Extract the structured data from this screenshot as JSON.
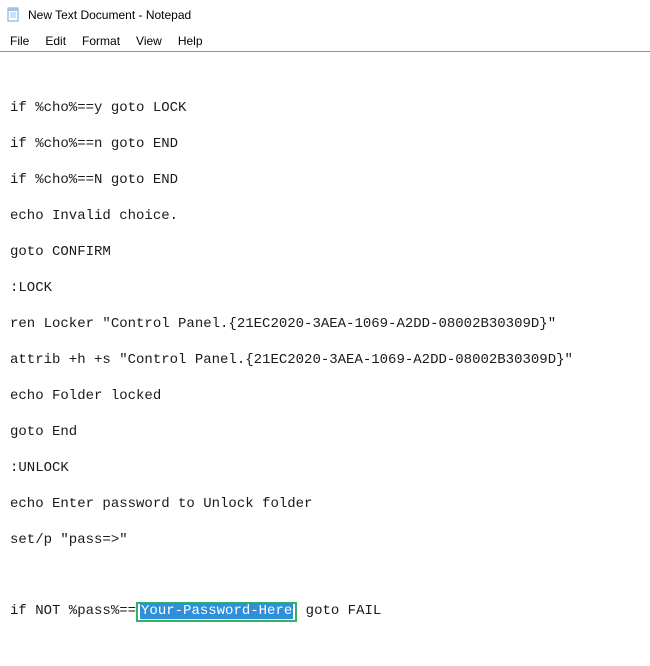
{
  "window": {
    "title": "New Text Document - Notepad"
  },
  "menu": {
    "items": [
      "File",
      "Edit",
      "Format",
      "View",
      "Help"
    ]
  },
  "editor": {
    "lines": [
      "if %cho%==y goto LOCK",
      "",
      "if %cho%==n goto END",
      "",
      "if %cho%==N goto END",
      "",
      "echo Invalid choice.",
      "",
      "goto CONFIRM",
      "",
      ":LOCK",
      "",
      "ren Locker \"Control Panel.{21EC2020-3AEA-1069-A2DD-08002B30309D}\"",
      "",
      "attrib +h +s \"Control Panel.{21EC2020-3AEA-1069-A2DD-08002B30309D}\"",
      "",
      "echo Folder locked",
      "",
      "goto End",
      "",
      ":UNLOCK",
      "",
      "echo Enter password to Unlock folder",
      "",
      "set/p \"pass=>\"",
      ""
    ],
    "last_line": {
      "prefix": "if NOT %pass%==",
      "highlight": "Your-Password-Here",
      "suffix": " goto FAIL"
    }
  }
}
